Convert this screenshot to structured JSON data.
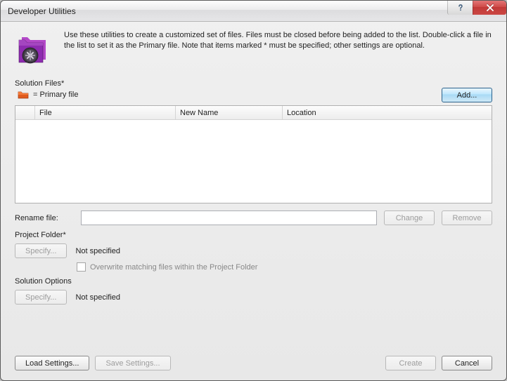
{
  "window": {
    "title": "Developer Utilities"
  },
  "intro": "Use these utilities to create a customized set of files. Files must be closed before being added to the list. Double-click a file in the list to set it as the Primary file. Note that items marked * must be specified; other settings are optional.",
  "sections": {
    "solution_files_label": "Solution Files*",
    "primary_legend": "= Primary file",
    "project_folder_label": "Project Folder*",
    "solution_options_label": "Solution Options"
  },
  "table": {
    "columns": {
      "file": "File",
      "new_name": "New Name",
      "location": "Location"
    },
    "rows": []
  },
  "buttons": {
    "add": "Add...",
    "change": "Change",
    "remove": "Remove",
    "specify_project": "Specify...",
    "specify_options": "Specify...",
    "load_settings": "Load Settings...",
    "save_settings": "Save Settings...",
    "create": "Create",
    "cancel": "Cancel"
  },
  "fields": {
    "rename_label": "Rename file:",
    "rename_value": "",
    "project_status": "Not specified",
    "options_status": "Not specified",
    "overwrite_label": "Overwrite matching files within the Project Folder",
    "overwrite_checked": false
  }
}
